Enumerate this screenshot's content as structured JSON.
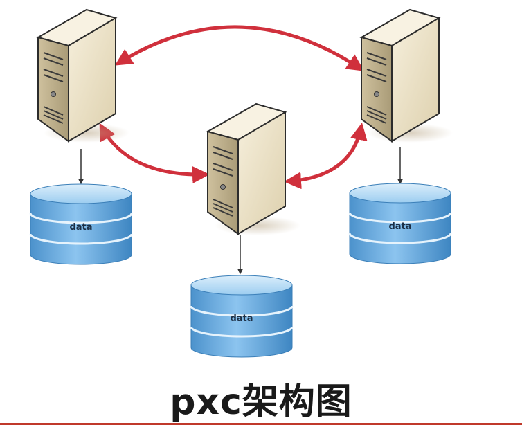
{
  "diagram": {
    "caption": "pxc架构图",
    "nodes": [
      {
        "id": "server-left",
        "kind": "server"
      },
      {
        "id": "server-center",
        "kind": "server"
      },
      {
        "id": "server-right",
        "kind": "server"
      }
    ],
    "databases": [
      {
        "id": "db-left",
        "label": "data"
      },
      {
        "id": "db-center",
        "label": "data"
      },
      {
        "id": "db-right",
        "label": "data"
      }
    ],
    "links": [
      {
        "from": "server-left",
        "to": "server-right",
        "direction": "bidirectional"
      },
      {
        "from": "server-left",
        "to": "server-center",
        "direction": "bidirectional"
      },
      {
        "from": "server-center",
        "to": "server-right",
        "direction": "bidirectional"
      },
      {
        "from": "server-left",
        "to": "db-left",
        "direction": "one-way"
      },
      {
        "from": "server-center",
        "to": "db-center",
        "direction": "one-way"
      },
      {
        "from": "server-right",
        "to": "db-right",
        "direction": "one-way"
      }
    ],
    "colors": {
      "replication_arrow": "#d0303c",
      "server_front": "#efe6cf",
      "server_side": "#cdbf9c",
      "server_top": "#f8f2e2",
      "db_blue": "#5aa4db",
      "db_light": "#a9d4f3"
    }
  }
}
